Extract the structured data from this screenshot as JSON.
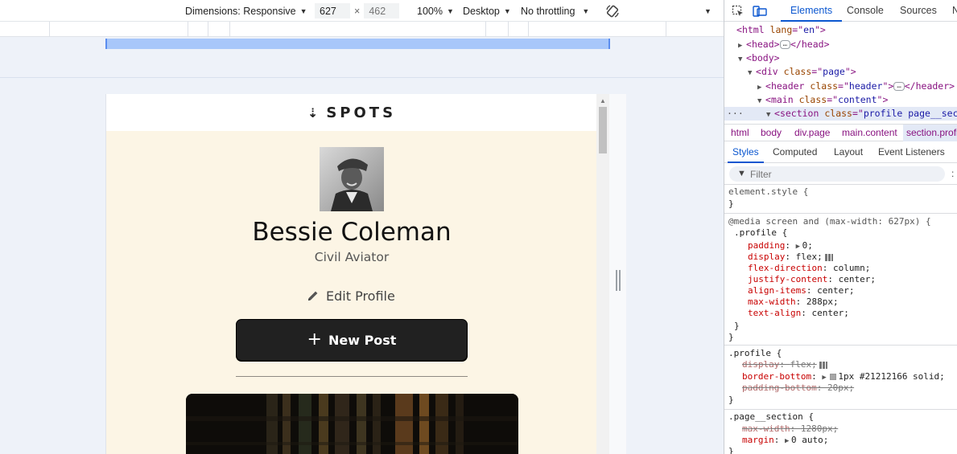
{
  "device_toolbar": {
    "dimensions_label": "Dimensions: Responsive",
    "width_value": "627",
    "height_placeholder": "462",
    "times_sign": "×",
    "zoom": "100%",
    "device_type": "Desktop",
    "throttling": "No throttling"
  },
  "site": {
    "logo_text": "SPOTS",
    "profile_name": "Bessie Coleman",
    "profile_role": "Civil Aviator",
    "edit_profile_label": "Edit Profile",
    "new_post_label": "New Post"
  },
  "devtools": {
    "tabs": [
      "Elements",
      "Console",
      "Sources",
      "N"
    ],
    "active_tab": "Elements",
    "dom_tree": [
      {
        "tag": "html",
        "attrs": [
          {
            "name": "lang",
            "value": "en"
          }
        ]
      },
      {
        "tag": "head",
        "collapsed": true
      },
      {
        "tag": "body"
      },
      {
        "tag": "div",
        "attrs": [
          {
            "name": "class",
            "value": "page"
          }
        ]
      },
      {
        "tag": "header",
        "attrs": [
          {
            "name": "class",
            "value": "header"
          }
        ],
        "collapsed": true
      },
      {
        "tag": "main",
        "attrs": [
          {
            "name": "class",
            "value": "content"
          }
        ]
      },
      {
        "tag": "section",
        "attrs": [
          {
            "name": "class",
            "value": "profile page__secti"
          }
        ],
        "selected": true
      }
    ],
    "breadcrumbs": [
      "html",
      "body",
      "div.page",
      "main.content",
      "section.profi"
    ],
    "sub_tabs": [
      "Styles",
      "Computed",
      "Layout",
      "Event Listeners"
    ],
    "active_sub_tab": "Styles",
    "filter_placeholder": "Filter",
    "styles": {
      "element_style": "element.style {",
      "media_rule": {
        "query": "@media screen and (max-width: 627px) {",
        "selector": ".profile {",
        "declarations": [
          {
            "prop": "padding",
            "value": "0;"
          },
          {
            "prop": "display",
            "value": "flex;"
          },
          {
            "prop": "flex-direction",
            "value": "column;"
          },
          {
            "prop": "justify-content",
            "value": "center;"
          },
          {
            "prop": "align-items",
            "value": "center;"
          },
          {
            "prop": "max-width",
            "value": "288px;"
          },
          {
            "prop": "text-align",
            "value": "center;"
          }
        ]
      },
      "profile_rule": {
        "selector": ".profile {",
        "declarations": [
          {
            "prop": "display",
            "value": "flex;",
            "overridden": true
          },
          {
            "prop": "border-bottom",
            "value": "1px #21212166 solid;"
          },
          {
            "prop": "padding-bottom",
            "value": "20px;",
            "overridden": true
          }
        ]
      },
      "page_section_rule": {
        "selector": ".page__section {",
        "declarations": [
          {
            "prop": "max-width",
            "value": "1280px;",
            "overridden": true
          },
          {
            "prop": "margin",
            "value": "0 auto;"
          }
        ]
      }
    }
  },
  "colors": {
    "page_background": "#fcf5e5",
    "button_background": "#212121",
    "devtools_accent": "#0b57d0",
    "media_query_bar": "#a8c7fa"
  }
}
